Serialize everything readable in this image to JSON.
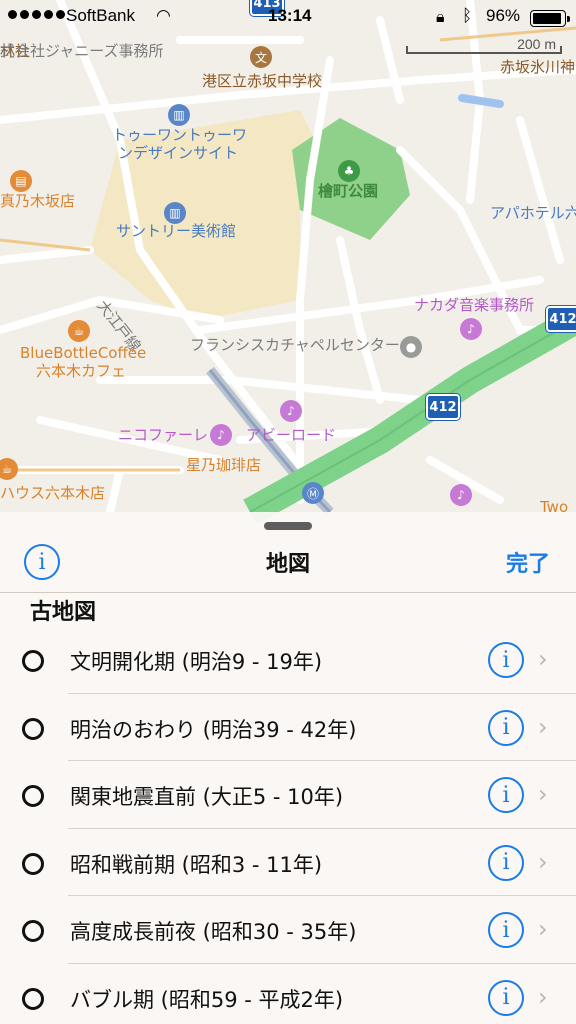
{
  "status_bar": {
    "carrier": "SoftBank",
    "time": "13:14",
    "battery": "96%",
    "battery_level": 0.96,
    "icons": [
      "signal-dots",
      "wifi-icon",
      "rotation-lock-icon",
      "bluetooth-icon",
      "battery-icon"
    ]
  },
  "map": {
    "scale_label": "200 m",
    "labels": {
      "top_left_edge": "林社",
      "agency": "式会社ジャニーズ事務所",
      "school": "港区立赤坂中学校",
      "right_top": "赤坂氷川神",
      "tower_line1": "トゥーワントゥーワ",
      "tower_line2": "ンデザインサイト",
      "park": "檜町公園",
      "nogizaka": "真乃木坂店",
      "museum": "サントリー美術館",
      "hotel": "アパホテル六",
      "street": "大江戸線",
      "music_office": "ナカダ音楽事務所",
      "bluebottle1": "BlueBottleCoffee",
      "bluebottle2": "六本木カフェ",
      "chapel": "フランシスカチャペルセンター",
      "nico": "ニコファーレ",
      "abbey": "アビーロード",
      "hoshino": "星乃珈琲店",
      "house": "ハウス六本木店",
      "two": "Two"
    },
    "routes": [
      "413",
      "412",
      "412"
    ],
    "colors": {
      "park": "#8fd18a",
      "land": "#f2efe9",
      "midtown": "#f4e7c3",
      "highway": "#7fd28a"
    }
  },
  "sheet": {
    "title": "地図",
    "done_label": "完了",
    "info_symbol": "i",
    "section_header": "古地図",
    "items": [
      {
        "label": "文明開化期 (明治9 - 19年)"
      },
      {
        "label": "明治のおわり (明治39 - 42年)"
      },
      {
        "label": "関東地震直前 (大正5 - 10年)"
      },
      {
        "label": "昭和戦前期 (昭和3 - 11年)"
      },
      {
        "label": "高度成長前夜 (昭和30 - 35年)"
      },
      {
        "label": "バブル期 (昭和59 - 平成2年)"
      }
    ],
    "accent_color": "#1a7ce6"
  }
}
